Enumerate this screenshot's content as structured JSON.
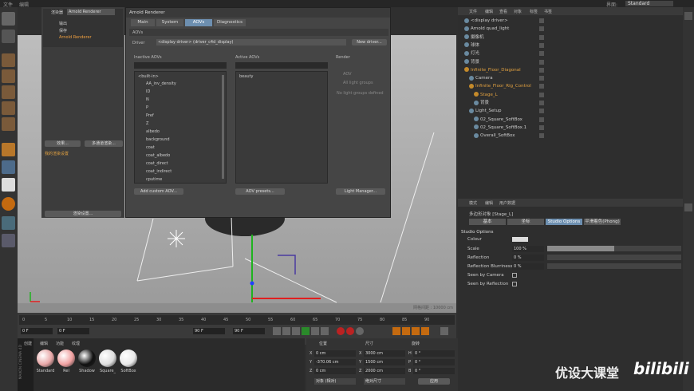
{
  "topmenu": {
    "file": "文件",
    "edit": "编辑"
  },
  "layout": {
    "label": "界面:",
    "value": "Standard"
  },
  "dlg_left": {
    "item1": "输出",
    "item2": "保存",
    "item3": "Arnold Renderer",
    "preset_btn": "效果...",
    "multi_btn": "多通道渲染...",
    "render_settings_btn": "渲染设置...",
    "my_settings": "我的渲染设置"
  },
  "render_select": {
    "label": "渲染器",
    "value": "Arnold Renderer"
  },
  "dialog": {
    "title": "Arnold Renderer",
    "tabs": [
      "Main",
      "System",
      "AOVs",
      "Diagnostics"
    ],
    "section": "AOVs",
    "driver_label": "Driver",
    "driver_value": "<display driver> (driver_c4d_display)",
    "new_driver_btn": "New driver...",
    "inactive_title": "Inactive AOVs",
    "active_title": "Active AOVs",
    "render_title": "Render",
    "builtin": "<built-in>",
    "inactive": [
      "AA_inv_density",
      "ID",
      "N",
      "P",
      "Pref",
      "Z",
      "albedo",
      "background",
      "coat",
      "coat_albedo",
      "coat_direct",
      "coat_indirect",
      "cputime"
    ],
    "active": [
      "beauty"
    ],
    "aov_opt": "AOV",
    "all_groups": "All light groups",
    "no_groups": "No light groups defined",
    "add_custom_btn": "Add custom AOV...",
    "aov_presets_btn": "AOV presets...",
    "light_manager_btn": "Light Manager..."
  },
  "viewport": {
    "grid_label": "网格间距 : 10000 cm"
  },
  "timeline": {
    "ticks": [
      "0",
      "5",
      "10",
      "15",
      "20",
      "25",
      "30",
      "35",
      "40",
      "45",
      "50",
      "55",
      "60",
      "65",
      "70",
      "75",
      "80",
      "85",
      "90"
    ],
    "start": "0 F",
    "current": "0 F",
    "end": "90 F",
    "end2": "90 F"
  },
  "materials": {
    "menu": [
      "创建",
      "编辑",
      "功能",
      "纹理"
    ],
    "items": [
      "Standard",
      "Rel",
      "Shadow",
      "Square_",
      "SoftBox"
    ],
    "colors": [
      "#e8a7a7",
      "#f0a0a0",
      "#111111",
      "#dddddd",
      "#e8e8e8"
    ],
    "brand": "MAXON CINEMA 4D"
  },
  "coords": {
    "headers": [
      "位置",
      "尺寸",
      "旋转"
    ],
    "x": [
      "0 cm",
      "3000 cm",
      "0 °"
    ],
    "y": [
      "-370.06 cm",
      "1500 cm",
      "0 °"
    ],
    "z": [
      "0 cm",
      "2000 cm",
      "0 °"
    ],
    "labels": [
      "X",
      "Y",
      "Z"
    ],
    "hpb": [
      "H",
      "P",
      "B"
    ],
    "mode1": "对象 (相对)",
    "mode2": "绝对尺寸",
    "apply": "应用"
  },
  "objects": {
    "menu": [
      "文件",
      "编辑",
      "查看",
      "对象",
      "标签",
      "书签"
    ],
    "items": [
      "<display driver>",
      "Arnold quad_light",
      "摄像机",
      "球体",
      "灯光",
      "背景",
      "Infinite_Floor_Diagonal",
      "Camera",
      "Infinite_Floor_Rig_Control",
      "Stage_L",
      "背景",
      "Light_Setup",
      "02_Square_SoftBox",
      "02_Square_SoftBox.1",
      "Overall_SoftBox"
    ]
  },
  "props": {
    "menu": [
      "模式",
      "编辑",
      "用户数据"
    ],
    "object": "多边形对象 [Stage_L]",
    "tabs": [
      "基本",
      "坐标",
      "Studio Options",
      "平滑着色(Phong)"
    ],
    "section": "Studio Options",
    "colour_label": "Colour",
    "scale_label": "Scale",
    "scale_value": "100 %",
    "scale_fill": 1.0,
    "refl_label": "Reflection",
    "refl_value": "0 %",
    "blur_label": "Reflection Blurriness",
    "blur_value": "0 %",
    "seen_cam": "Seen by Camera",
    "seen_refl": "Seen by Reflection"
  },
  "watermark": {
    "text": "优设大课堂",
    "logo": "bilibili"
  }
}
